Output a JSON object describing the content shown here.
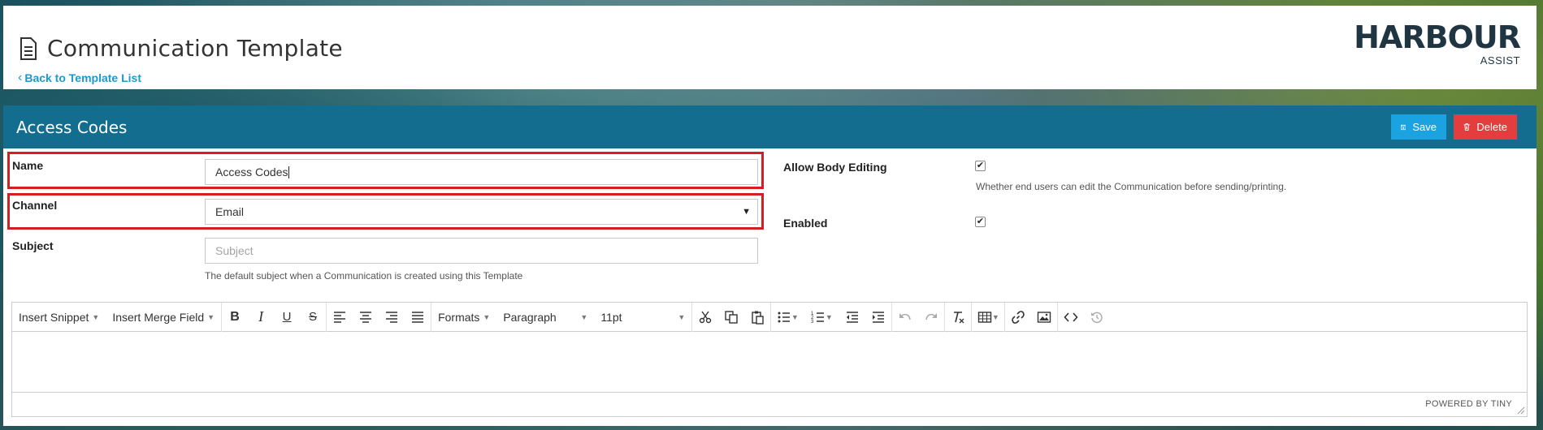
{
  "header": {
    "title": "Communication Template",
    "back_link": "Back to Template List",
    "logo_main": "HARBOUR",
    "logo_sub": "ASSIST"
  },
  "panel": {
    "title": "Access Codes",
    "save_label": "Save",
    "delete_label": "Delete"
  },
  "form": {
    "name_label": "Name",
    "name_value": "Access Codes",
    "channel_label": "Channel",
    "channel_value": "Email",
    "subject_label": "Subject",
    "subject_placeholder": "Subject",
    "subject_help": "The default subject when a Communication is created using this Template",
    "allow_body_label": "Allow Body Editing",
    "allow_body_checked": true,
    "allow_body_help": "Whether end users can edit the Communication before sending/printing.",
    "enabled_label": "Enabled",
    "enabled_checked": true
  },
  "editor": {
    "insert_snippet": "Insert Snippet",
    "insert_merge_field": "Insert Merge Field",
    "formats": "Formats",
    "paragraph": "Paragraph",
    "font_size": "11pt",
    "powered_by": "POWERED BY TINY"
  },
  "colors": {
    "panel_header": "#136d8e",
    "save_button": "#1aa3e0",
    "delete_button": "#e43d3d",
    "link": "#1b9ad1",
    "highlight": "#d31f1f"
  }
}
